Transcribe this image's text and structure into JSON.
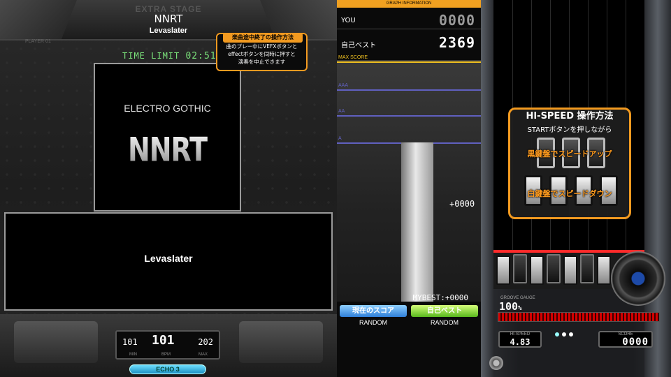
{
  "header": {
    "stage": "EXTRA STAGE",
    "song_title": "NNRT",
    "artist": "Levaslater",
    "player": "PLAYER 01"
  },
  "time_limit": {
    "label": "TIME LIMIT",
    "value": "02:51"
  },
  "jacket": {
    "genre": "ELECTRO GOTHIC",
    "title": "NNRT"
  },
  "bga": {
    "artist": "Levaslater"
  },
  "bpm": {
    "min": "101",
    "current": "101",
    "max": "202",
    "min_label": "MIN",
    "bpm_label": "BPM",
    "max_label": "MAX"
  },
  "effect": "ECHO 3",
  "tooltip": {
    "title": "楽曲途中終了の操作方法",
    "lines": [
      "曲のプレー中にVEFXボタンと",
      "effectボタンを同時に押すと",
      "演奏を中止できます"
    ]
  },
  "graph": {
    "header": "GRAPH INFORMATION",
    "you_label": "YOU",
    "you_score": "0000",
    "best_label": "自己ベスト",
    "best_score": "2369",
    "lines": [
      {
        "label": "MAX SCORE",
        "color": "#f0c020"
      },
      {
        "label": "AAA",
        "color": "#6060c0"
      },
      {
        "label": "AA",
        "color": "#6060c0"
      },
      {
        "label": "A",
        "color": "#6060c0"
      }
    ],
    "my_best_bar_fraction": 0.66,
    "mybest_diff": "MYBEST:+0000",
    "plus_score": "+0000",
    "buttons": [
      {
        "label": "現在のスコア",
        "option": "RANDOM"
      },
      {
        "label": "自己ベスト",
        "option": "RANDOM"
      }
    ]
  },
  "hispeed_help": {
    "title": "HI-SPEED 操作方法",
    "subtitle": "STARTボタンを押しながら",
    "up": "黒鍵盤でスピードアップ",
    "down": "白鍵盤でスピードダウン"
  },
  "groove_gauge": {
    "label": "GROOVE GAUGE",
    "value": "100",
    "unit": "%",
    "fraction": 1.0
  },
  "hi_speed": {
    "label": "HI-SPEED",
    "value": "4.83"
  },
  "score": {
    "label": "SCORE",
    "value": "0000"
  },
  "colors": {
    "accent_orange": "#f29a20",
    "gauge_red": "#d40000",
    "judge_red": "#ff2a2a",
    "effect_cyan": "#6fe0ff"
  }
}
